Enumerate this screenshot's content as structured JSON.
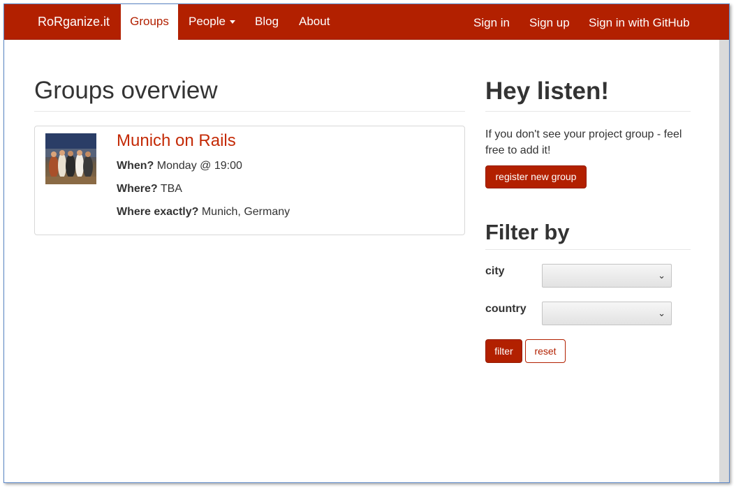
{
  "navbar": {
    "brand": "RoRganize.it",
    "items": [
      {
        "label": "Groups",
        "active": true
      },
      {
        "label": "People",
        "dropdown": true
      },
      {
        "label": "Blog"
      },
      {
        "label": "About"
      }
    ],
    "right": [
      "Sign in",
      "Sign up",
      "Sign in with GitHub"
    ]
  },
  "main": {
    "title": "Groups overview",
    "groups": [
      {
        "name": "Munich on Rails",
        "when_label": "When?",
        "when": "Monday @ 19:00",
        "where_label": "Where?",
        "where": "TBA",
        "where_exactly_label": "Where exactly?",
        "where_exactly": "Munich, Germany"
      }
    ]
  },
  "sidebar": {
    "title": "Hey listen!",
    "text": "If you don't see your project group - feel free to add it!",
    "register_button": "register new group",
    "filter_title": "Filter by",
    "filters": [
      {
        "label": "city",
        "value": ""
      },
      {
        "label": "country",
        "value": ""
      }
    ],
    "filter_button": "filter",
    "reset_button": "reset"
  },
  "colors": {
    "brand": "#b22000",
    "link": "#c42a06",
    "text": "#333333"
  }
}
